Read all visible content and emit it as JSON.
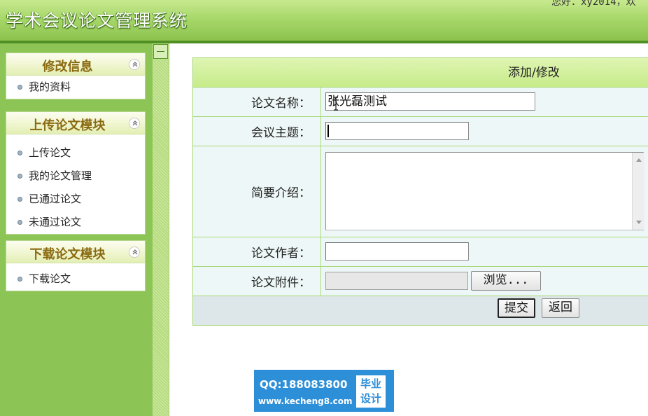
{
  "header": {
    "title": "学术会议论文管理系统",
    "welcome": "您好：xy2014，欢"
  },
  "sidebar": {
    "panels": [
      {
        "title": "修改信息",
        "items": [
          "我的资料"
        ]
      },
      {
        "title": "上传论文模块",
        "items": [
          "上传论文",
          "我的论文管理",
          "已通过论文",
          "未通过论文"
        ]
      },
      {
        "title": "下载论文模块",
        "items": [
          "下载论文"
        ]
      }
    ]
  },
  "form": {
    "heading": "添加/修改",
    "fields": {
      "name_label": "论文名称：",
      "name_value": "张光磊测试",
      "topic_label": "会议主题：",
      "topic_value": "",
      "intro_label": "简要介绍：",
      "intro_value": "",
      "author_label": "论文作者：",
      "author_value": "",
      "attach_label": "论文附件：",
      "attach_value": ""
    },
    "buttons": {
      "browse": "浏览...",
      "submit": "提交",
      "back": "返回"
    }
  },
  "watermark": {
    "qq": "QQ:188083800",
    "url": "www.kecheng8.com",
    "badge_line1": "毕业",
    "badge_line2": "设计"
  },
  "colors": {
    "header_green": "#8cc24e",
    "sidebar_green": "#8cc555",
    "panel_title": "#8a6a10",
    "watermark_blue": "#2d8fd8"
  }
}
